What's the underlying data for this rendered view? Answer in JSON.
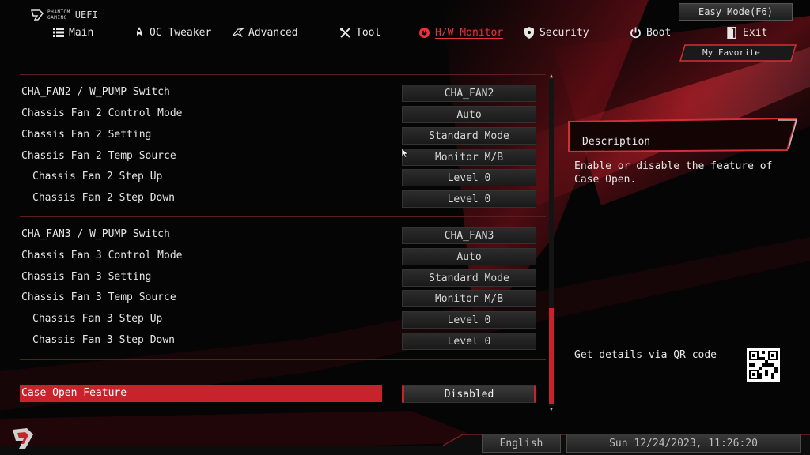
{
  "brand": {
    "line1": "PHANTOM",
    "line2": "GAMING",
    "uefi": "UEFI"
  },
  "easy_mode_label": "Easy Mode(F6)",
  "nav": [
    {
      "label": "Main",
      "icon": "list-icon"
    },
    {
      "label": "OC Tweaker",
      "icon": "rocket-icon"
    },
    {
      "label": "Advanced",
      "icon": "star-icon"
    },
    {
      "label": "Tool",
      "icon": "wrench-icon"
    },
    {
      "label": "H/W Monitor",
      "icon": "monitor-gauge-icon",
      "active": true
    },
    {
      "label": "Security",
      "icon": "shield-icon"
    },
    {
      "label": "Boot",
      "icon": "power-icon"
    },
    {
      "label": "Exit",
      "icon": "exit-door-icon"
    }
  ],
  "favorite_label": "My Favorite",
  "settings": {
    "fan2": [
      {
        "label": "CHA_FAN2 / W_PUMP Switch",
        "value": "CHA_FAN2"
      },
      {
        "label": "Chassis Fan 2 Control Mode",
        "value": "Auto"
      },
      {
        "label": "Chassis Fan 2 Setting",
        "value": "Standard Mode"
      },
      {
        "label": "Chassis Fan 2 Temp Source",
        "value": "Monitor M/B"
      },
      {
        "label": "Chassis Fan 2 Step Up",
        "value": "Level 0"
      },
      {
        "label": "Chassis Fan 2 Step Down",
        "value": "Level 0"
      }
    ],
    "fan3": [
      {
        "label": "CHA_FAN3 / W_PUMP Switch",
        "value": "CHA_FAN3"
      },
      {
        "label": "Chassis Fan 3 Control Mode",
        "value": "Auto"
      },
      {
        "label": "Chassis Fan 3 Setting",
        "value": "Standard Mode"
      },
      {
        "label": "Chassis Fan 3 Temp Source",
        "value": "Monitor M/B"
      },
      {
        "label": "Chassis Fan 3 Step Up",
        "value": "Level 0"
      },
      {
        "label": "Chassis Fan 3 Step Down",
        "value": "Level 0"
      }
    ],
    "case_open": {
      "label": "Case Open Feature",
      "value": "Disabled"
    }
  },
  "description": {
    "title": "Description",
    "text": "Enable or disable the feature of Case Open."
  },
  "qr_text": "Get details via QR code",
  "language": "English",
  "datetime": "Sun 12/24/2023, 11:26:20",
  "colors": {
    "accent": "#c8232c",
    "active_nav": "#e8333b",
    "background": "#050505"
  }
}
